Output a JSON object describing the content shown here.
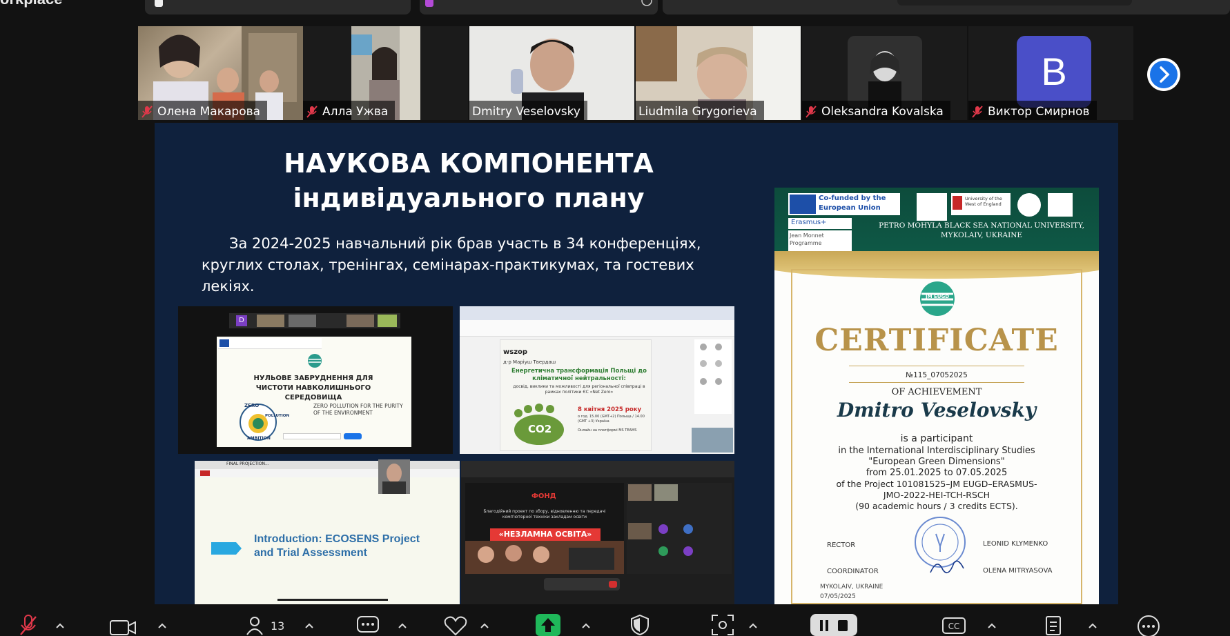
{
  "app": {
    "title": "orkplace"
  },
  "gallery": {
    "participants": [
      {
        "name": "Олена Макарова",
        "muted": true
      },
      {
        "name": "Алла Ужва",
        "muted": true
      },
      {
        "name": "Dmitry Veselovsky",
        "muted": false,
        "active": true
      },
      {
        "name": "Liudmila Grygorieva",
        "muted": false
      },
      {
        "name": "Oleksandra Kovalska",
        "muted": true
      },
      {
        "name": "Виктор Смирнов",
        "muted": true,
        "avatar_letter": "B"
      }
    ]
  },
  "slide": {
    "title_line1": "НАУКОВА КОМПОНЕНТА",
    "title_line2": "індивідуального плану",
    "body": "За 2024-2025 навчальний рік брав участь в 34 конференціях, круглих столах, тренінгах, семінарах-практикумах, та гостевих лекіях.",
    "shot1": {
      "letter": "D",
      "heading": "НУЛЬОВЕ ЗАБРУДНЕННЯ ДЛЯ ЧИСТОТИ НАВКОЛИШНЬОГО СЕРЕДОВИЩА",
      "subheading": "ZERO POLLUTION FOR THE PURITY OF THE ENVIRONMENT",
      "badge_top": "ZERO",
      "badge_side": "POLLUTION",
      "badge_bottom": "AMBITION"
    },
    "shot2": {
      "brand": "wszop",
      "speaker": "д-р Маріуш Твердаш",
      "heading": "Енергетична трансформація Польщі до кліматичної нейтральності:",
      "subheading": "досвід, виклики та можливості для регіональної співпраці в рамках політики ЄС «Net Zero»",
      "date": "8 квітня 2025 року",
      "time": "о год. 15.00 (GMT+2) Польща / 14.00 (GMT +3) Україна",
      "co2": "CO2",
      "platform": "Онлайн на платформі MS TEAMS"
    },
    "shot3": {
      "tab": "FINAL PROJECTION...",
      "title": "Introduction: ECOSENS Project and Trial Assessment"
    },
    "shot4": {
      "fund": "ФОНД",
      "project_text": "Благодійний проект по збору, відновленню та передачі комп'ютерної техніки закладам освіти",
      "banner": "«НЕЗЛАМНА ОСВІТА»"
    }
  },
  "certificate": {
    "cofunded": "Co-funded by the European Union",
    "erasmus": "Erasmus+",
    "jean_monnet": "Jean Monnet Programme",
    "uwe": "University of the West of England",
    "university": "PETRO MOHYLA BLACK SEA NATIONAL UNIVERSITY, MYKOLAIV, UKRAINE",
    "logo_text": "JM EUGD",
    "title": "CERTIFICATE",
    "number": "№115_07052025",
    "of_achievement": "OF ACHIEVEMENT",
    "recipient": "Dmitro Veselovsky",
    "line1": "is a participant",
    "line2": "in the International Interdisciplinary Studies",
    "line3": "\"European Green Dimensions\"",
    "line4": "from 25.01.2025 to 07.05.2025",
    "line5": "of the Project 101081525–JM EUGD–ERASMUS-",
    "line6": "JMO-2022-HEI-TCH-RSCH",
    "line7": "(90 academic hours / 3 credits ECTS).",
    "rector_label": "RECTOR",
    "rector_name": "LEONID KLYMENKO",
    "coordinator_label": "COORDINATOR",
    "coordinator_name": "OLENA MITRYASOVA",
    "place": "MYKOLAIV, UKRAINE",
    "date": "07/05/2025"
  },
  "toolbar": {
    "participants_count": "13"
  },
  "colors": {
    "active_speaker": "#21d07a",
    "share_green": "#1fb85a",
    "slide_bg": "#0f213d",
    "cert_gold": "#b8934a",
    "cert_green": "#0d4c3c"
  }
}
